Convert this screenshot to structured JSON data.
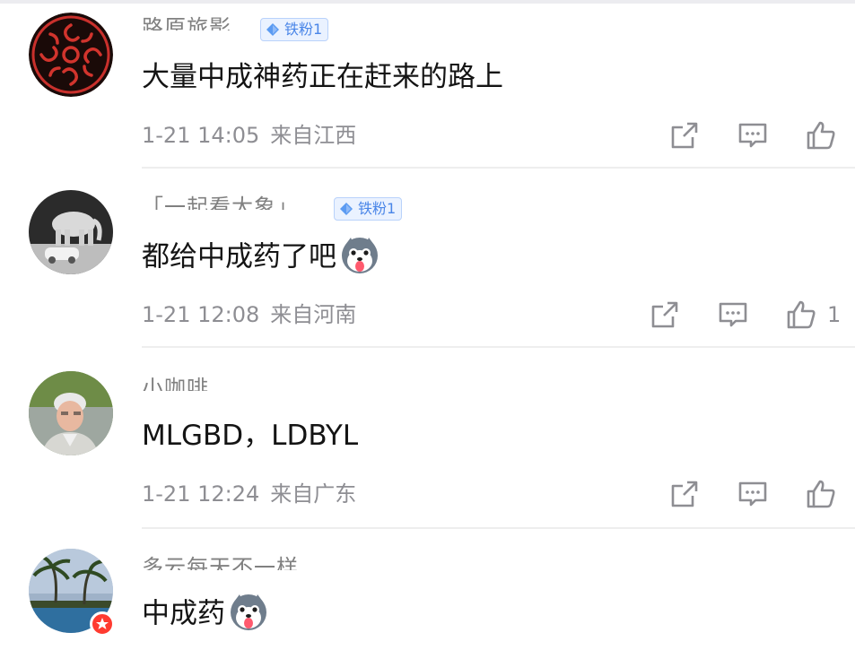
{
  "comments": [
    {
      "username": "路原旅影",
      "badge": "铁粉1",
      "text": "大量中成神药正在赶来的路上",
      "date": "1-21 14:05",
      "location": "来自江西",
      "likes": ""
    },
    {
      "username": "「一起看大象」",
      "badge": "铁粉1",
      "text": "都给中成药了吧",
      "date": "1-21 12:08",
      "location": "来自河南",
      "likes": "1"
    },
    {
      "username": "小咖啡",
      "badge": "",
      "text": "MLGBD，LDBYL",
      "date": "1-21 12:24",
      "location": "来自广东",
      "likes": ""
    },
    {
      "username": "多云每天不一样",
      "badge": "",
      "text": "中成药",
      "date": "",
      "location": "",
      "likes": ""
    }
  ],
  "icons": {
    "share": "share-icon",
    "comment": "comment-icon",
    "like": "thumbs-up-icon",
    "emoji": "husky-emoji-icon",
    "badge": "diamond-icon"
  },
  "colors": {
    "badge_text": "#4a86e8",
    "meta_text": "#8e8e93",
    "verified": "#ff3b30"
  }
}
